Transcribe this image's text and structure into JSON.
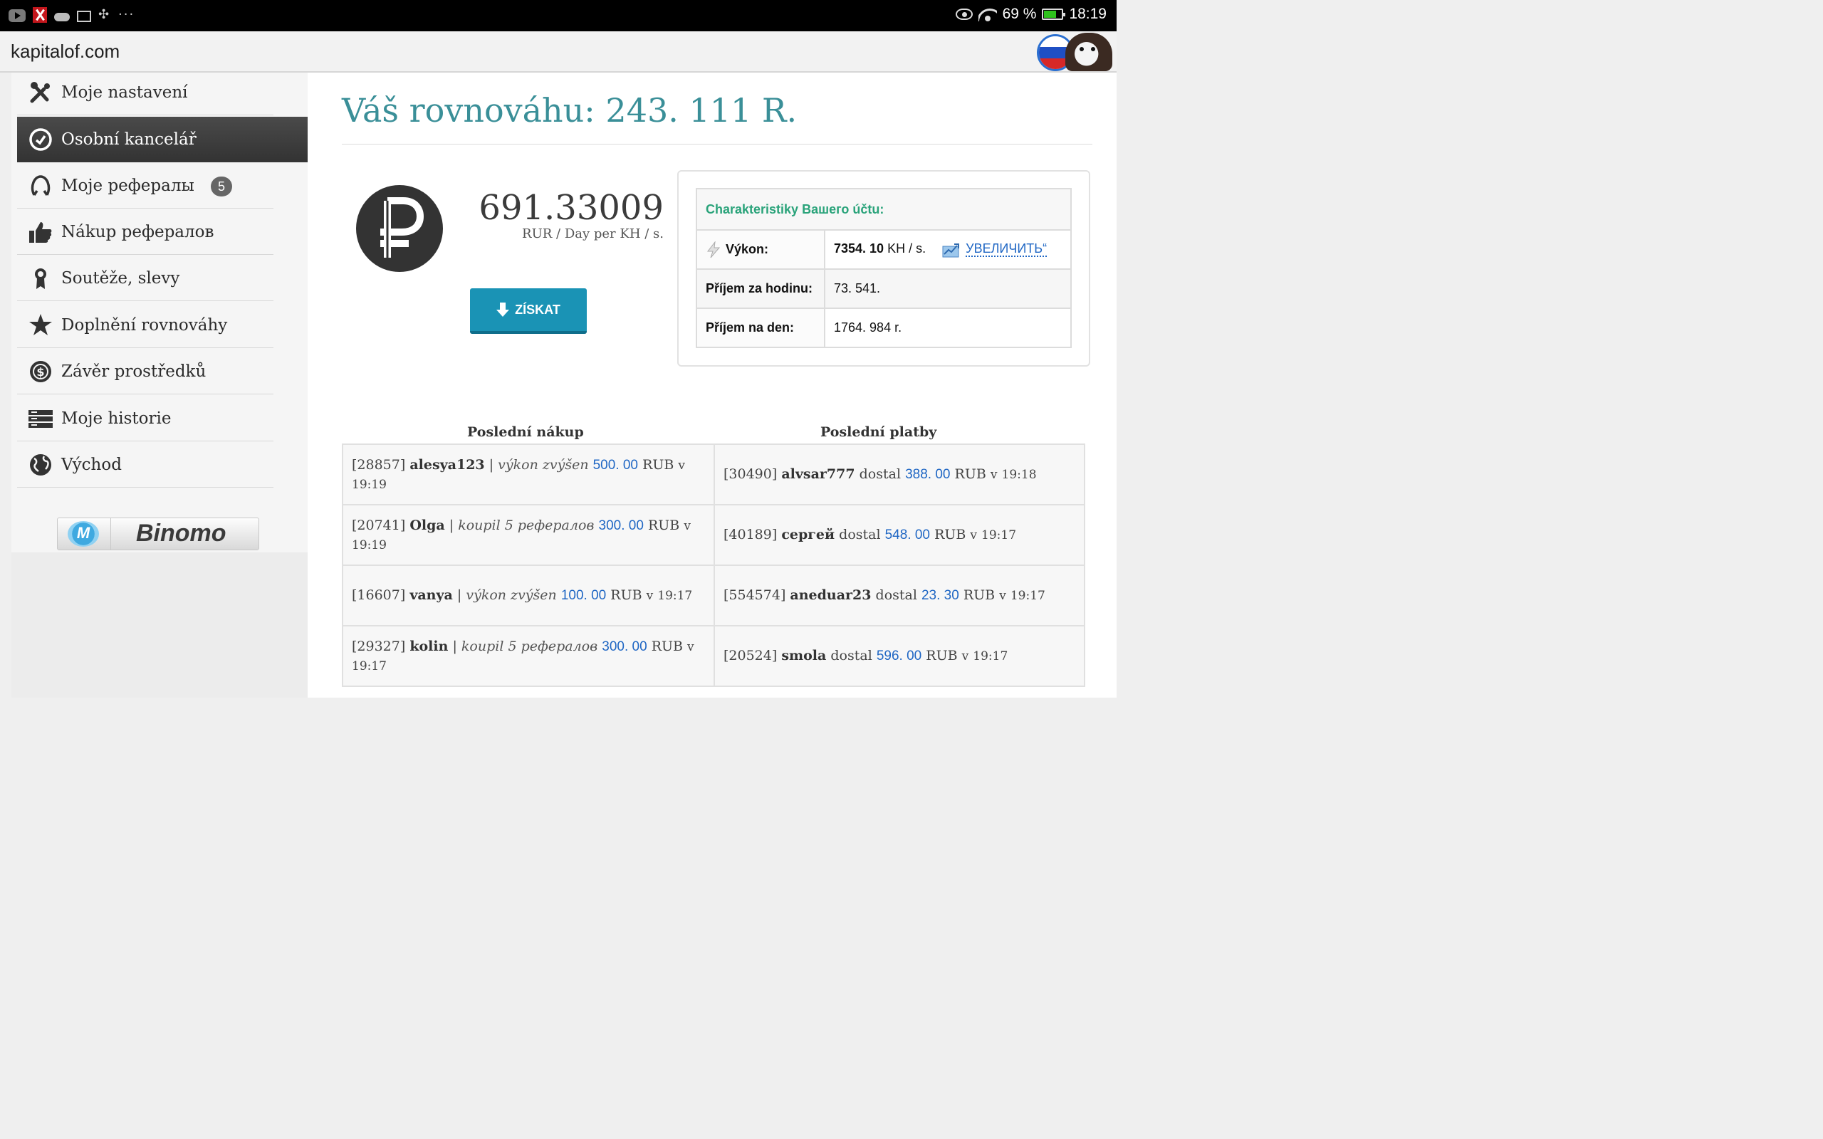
{
  "statusbar": {
    "battery": "69 %",
    "battery_level": 0.69,
    "time": "18:19",
    "more": "···",
    "icons": [
      "youtube-icon",
      "x-app-icon",
      "cloud-icon",
      "mail-icon",
      "pinwheel-icon",
      "eye-icon",
      "wifi-icon",
      "battery-icon"
    ]
  },
  "browser": {
    "url": "kapitalof.com"
  },
  "sidebar": {
    "items": [
      {
        "label": "Moje nastavení",
        "icon": "tools-icon"
      },
      {
        "label": "Osobní kancelář",
        "icon": "clock-icon",
        "active": true
      },
      {
        "label": "Moje рефералы",
        "icon": "referrals-icon",
        "badge": "5"
      },
      {
        "label": "Nákup рефералов",
        "icon": "thumbs-up-icon"
      },
      {
        "label": "Soutěže, slevy",
        "icon": "award-icon"
      },
      {
        "label": "Doplnění rovnováhy",
        "icon": "star-icon"
      },
      {
        "label": "Závěr prostředků",
        "icon": "dollar-coin-icon"
      },
      {
        "label": "Moje historie",
        "icon": "server-icon"
      },
      {
        "label": "Východ",
        "icon": "globe-icon"
      }
    ],
    "ad": {
      "brand": "Binomo"
    }
  },
  "main": {
    "title": "Váš rovnováhu: 243. 111 R.",
    "rate": "691.33009",
    "rate_unit": "RUR / Day per KH / s.",
    "get_button": "ZÍSKAT",
    "stats": {
      "header": "Charakteristiky Вашего účtu:",
      "power_label": "Výkon:",
      "power_value": "7354. 10",
      "power_unit": "KH / s.",
      "increase_link": "УВЕЛИЧИТЬ“",
      "hour_label": "Příjem za hodinu:",
      "hour_value": "73. 541.",
      "day_label": "Příjem na den:",
      "day_value": "1764. 984 r."
    },
    "purchases_header": "Poslední nákup",
    "payments_header": "Poslední platby",
    "purchases": [
      {
        "id": "[28857]",
        "user": "alesya123",
        "sep": "|",
        "action": "výkon zvýšen",
        "amount": "500. 00",
        "cur": "RUB",
        "at": "v",
        "time": "19:19"
      },
      {
        "id": "[20741]",
        "user": "Olga",
        "sep": "|",
        "action": "koupil 5 рефералов",
        "amount": "300. 00",
        "cur": "RUB",
        "at": "v",
        "time": "19:19"
      },
      {
        "id": "[16607]",
        "user": "vanya",
        "sep": "|",
        "action": "výkon zvýšen",
        "amount": "100. 00",
        "cur": "RUB",
        "at": "v",
        "time": "19:17"
      },
      {
        "id": "[29327]",
        "user": "kolin",
        "sep": "|",
        "action": "koupil 5 рефералов",
        "amount": "300. 00",
        "cur": "RUB",
        "at": "v",
        "time": "19:17"
      }
    ],
    "payments": [
      {
        "id": "[30490]",
        "user": "alvsar777",
        "action": "dostal",
        "amount": "388. 00",
        "cur": "RUB",
        "at": "v",
        "time": "19:18"
      },
      {
        "id": "[40189]",
        "user": "сергей",
        "action": "dostal",
        "amount": "548. 00",
        "cur": "RUB",
        "at": "v",
        "time": "19:17"
      },
      {
        "id": "[554574]",
        "user": "aneduar23",
        "action": "dostal",
        "amount": "23. 30",
        "cur": "RUB",
        "at": "v",
        "time": "19:17"
      },
      {
        "id": "[20524]",
        "user": "smola",
        "action": "dostal",
        "amount": "596. 00",
        "cur": "RUB",
        "at": "v",
        "time": "19:17"
      }
    ]
  }
}
